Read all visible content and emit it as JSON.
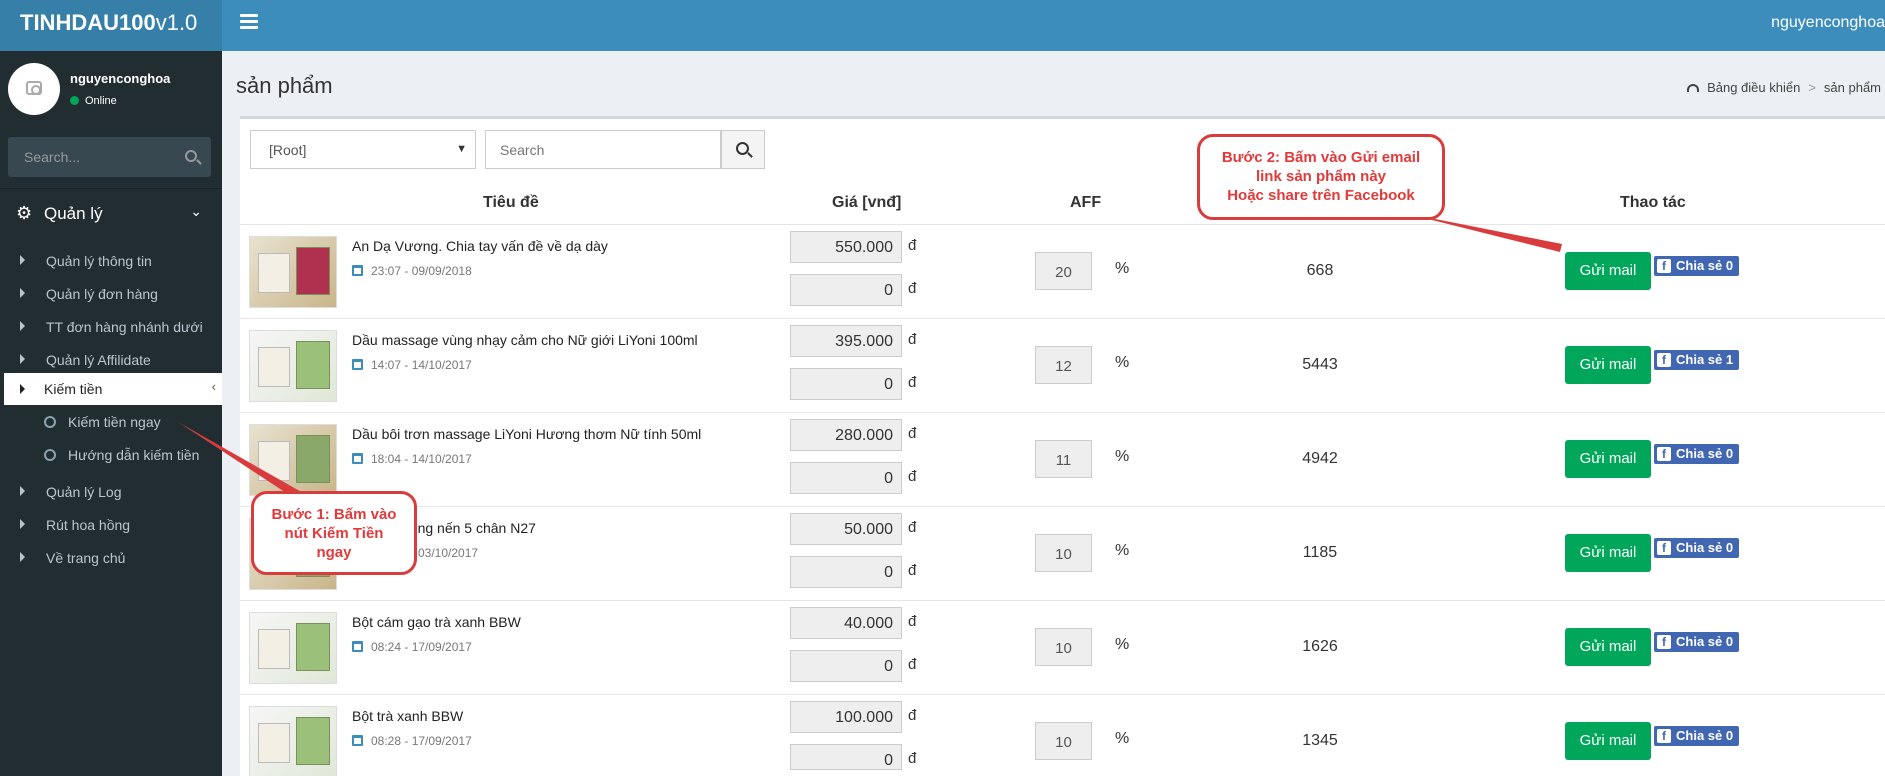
{
  "header": {
    "logo_bold": "TINHDAU100",
    "logo_version": "v1.0",
    "username": "nguyenconghoa"
  },
  "sidebar": {
    "user_name": "nguyenconghoa",
    "user_status": "Online",
    "search_placeholder": "Search...",
    "section_label": "Quản lý",
    "items": [
      {
        "label": "Quản lý thông tin"
      },
      {
        "label": "Quản lý đơn hàng"
      },
      {
        "label": "TT đơn hàng nhánh dưới"
      },
      {
        "label": "Quản lý Affilidate"
      },
      {
        "label": "Kiếm tiền"
      },
      {
        "label": "Kiếm tiền ngay"
      },
      {
        "label": "Hướng dẫn kiếm tiền"
      },
      {
        "label": "Quản lý Log"
      },
      {
        "label": "Rút hoa hồng"
      },
      {
        "label": "Về trang chủ"
      }
    ]
  },
  "page": {
    "title": "sản phẩm",
    "breadcrumb_home": "Bảng điều khiển",
    "breadcrumb_current": "sản phẩm"
  },
  "filters": {
    "category_selected": "[Root]",
    "search_placeholder": "Search"
  },
  "table": {
    "columns": {
      "title": "Tiêu đề",
      "price": "Giá [vnđ]",
      "aff": "AFF",
      "actions": "Thao tác"
    },
    "currency": "đ",
    "percent_sign": "%",
    "mail_label": "Gửi mail",
    "share_label": "Chia sẻ 0",
    "rows": [
      {
        "title": "An Dạ Vương. Chia tay vấn đề về dạ dày",
        "date": "23:07 - 09/09/2018",
        "price": "550.000",
        "price2": "0",
        "aff": "20",
        "count": "668",
        "share": "Chia sẻ 0"
      },
      {
        "title": "Dầu massage vùng nhạy cảm cho Nữ giới LiYoni 100ml",
        "date": "14:07 - 14/10/2017",
        "price": "395.000",
        "price2": "0",
        "aff": "12",
        "count": "5443",
        "share": "Chia sẻ 1"
      },
      {
        "title": "Dầu bôi trơn massage LiYoni Hương thơm Nữ tính 50ml",
        "date": "18:04 - 14/10/2017",
        "price": "280.000",
        "price2": "0",
        "aff": "11",
        "count": "4942",
        "share": "Chia sẻ 0"
      },
      {
        "title": "dùng nến 5 chân N27",
        "date": "03/10/2017",
        "price": "50.000",
        "price2": "0",
        "aff": "10",
        "count": "1185",
        "share": "Chia sẻ 0"
      },
      {
        "title": "Bột cám gạo trà xanh BBW",
        "date": "08:24 - 17/09/2017",
        "price": "40.000",
        "price2": "0",
        "aff": "10",
        "count": "1626",
        "share": "Chia sẻ 0"
      },
      {
        "title": "Bột trà xanh BBW",
        "date": "08:28 - 17/09/2017",
        "price": "100.000",
        "price2": "0",
        "aff": "10",
        "count": "1345",
        "share": "Chia sẻ 0"
      }
    ]
  },
  "callouts": {
    "step2_line1": "Bước 2: Bấm vào Gửi email",
    "step2_line2": "link sản phẩm này",
    "step2_line3": "Hoặc share trên Facebook",
    "step1_line1": "Bước 1: Bấm vào",
    "step1_line2": "nút Kiếm Tiền",
    "step1_line3": "ngay"
  },
  "colors": {
    "header": "#3c8dbc",
    "logo_bg": "#367fa9",
    "sidebar": "#222d32",
    "success": "#00a65a",
    "facebook": "#4267b2",
    "callout": "#d93c3c"
  }
}
